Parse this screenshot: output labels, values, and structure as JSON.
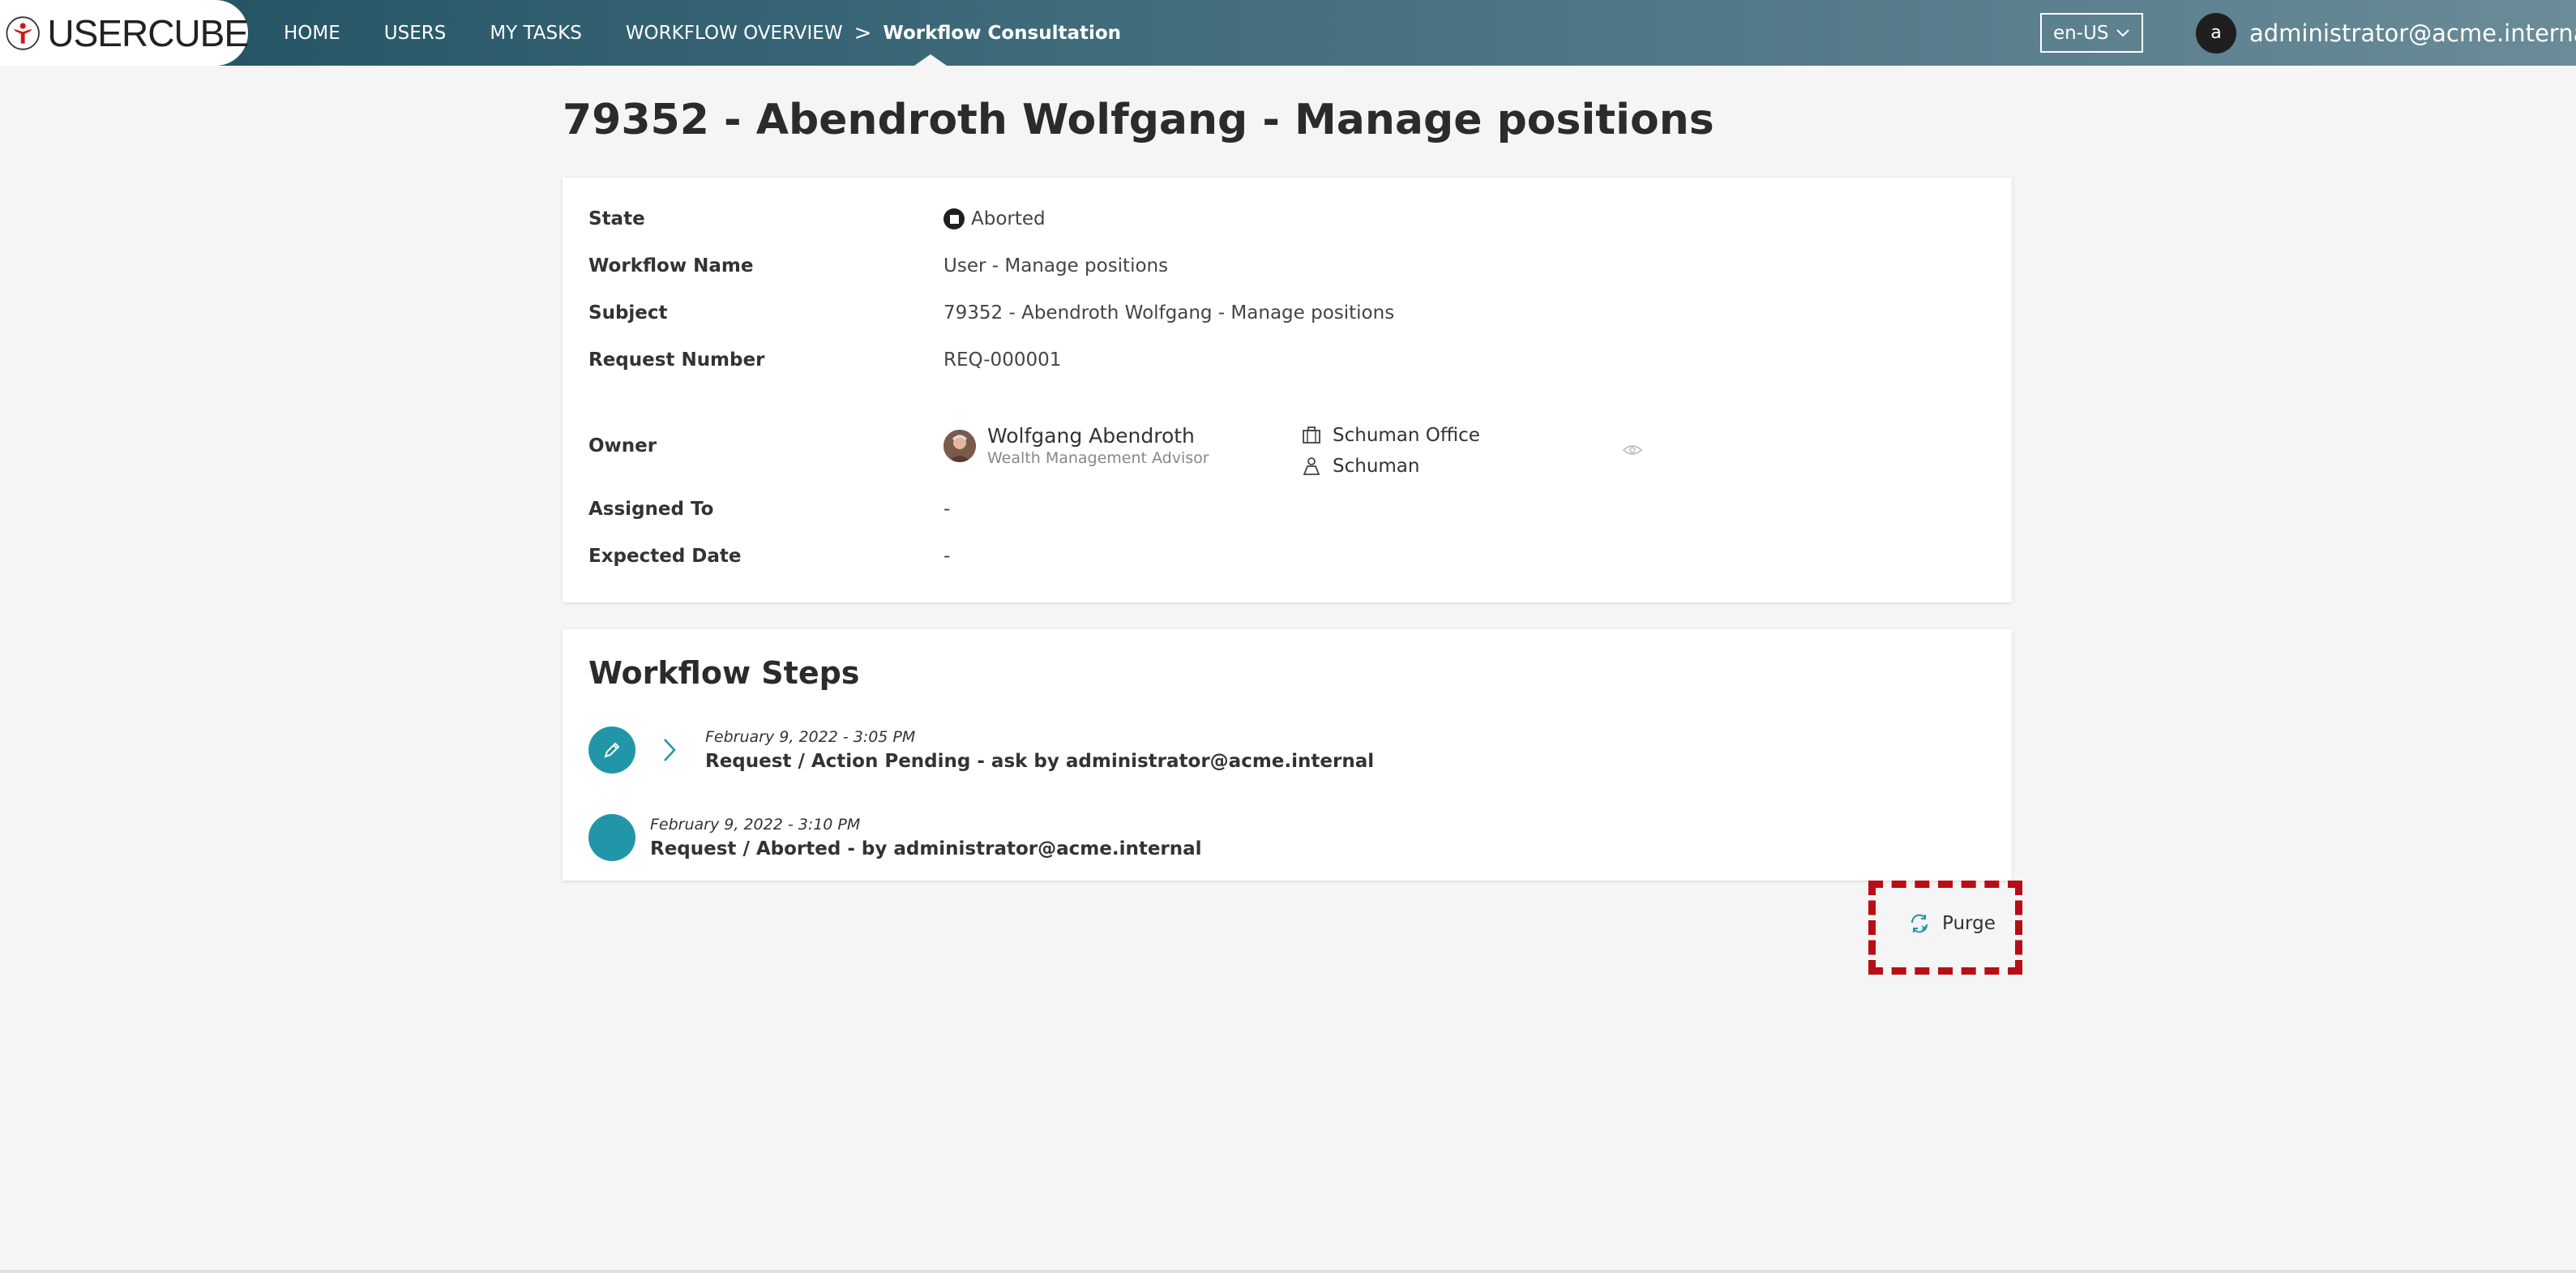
{
  "app": {
    "logo_text": "USERCUBE"
  },
  "nav": {
    "home": "HOME",
    "users": "USERS",
    "my_tasks": "MY TASKS",
    "workflow_overview": "WORKFLOW OVERVIEW",
    "separator": ">",
    "current": "Workflow Consultation"
  },
  "header": {
    "language": "en-US",
    "user_initial": "a",
    "user_email": "administrator@acme.internal"
  },
  "page": {
    "title": "79352 - Abendroth Wolfgang - Manage positions"
  },
  "details": {
    "state_label": "State",
    "state_value": "Aborted",
    "workflow_name_label": "Workflow Name",
    "workflow_name_value": "User - Manage positions",
    "subject_label": "Subject",
    "subject_value": "79352 - Abendroth Wolfgang - Manage positions",
    "request_number_label": "Request Number",
    "request_number_value": "REQ-000001",
    "owner_label": "Owner",
    "owner_name": "Wolfgang Abendroth",
    "owner_title": "Wealth Management Advisor",
    "owner_office": "Schuman Office",
    "owner_location": "Schuman",
    "assigned_to_label": "Assigned To",
    "assigned_to_value": "-",
    "expected_date_label": "Expected Date",
    "expected_date_value": "-"
  },
  "steps": {
    "title": "Workflow Steps",
    "items": [
      {
        "date": "February 9, 2022  - 3:05 PM",
        "text": "Request / Action Pending - ask by administrator@acme.internal"
      },
      {
        "date": "February 9, 2022  - 3:10 PM",
        "text": "Request / Aborted - by administrator@acme.internal"
      }
    ]
  },
  "actions": {
    "purge_label": "Purge"
  },
  "colors": {
    "accent": "#2196a8",
    "highlight_border": "#b80e14",
    "topbar_start": "#1f5060"
  }
}
